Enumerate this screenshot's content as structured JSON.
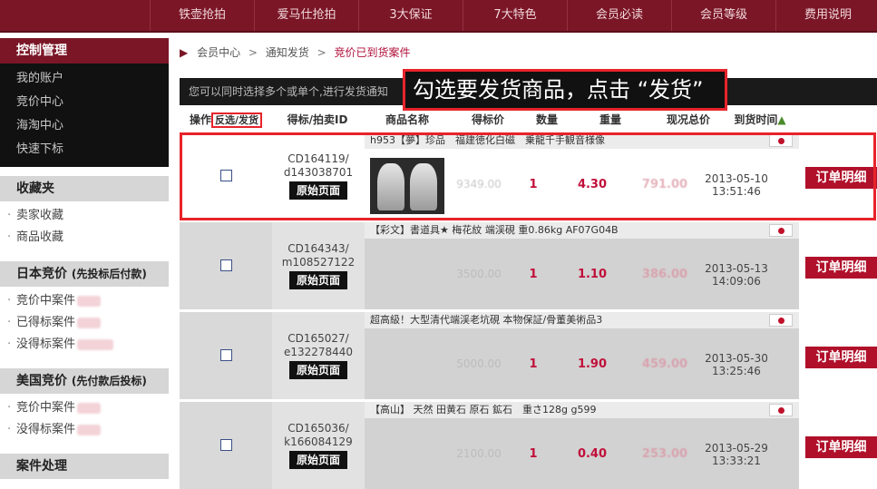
{
  "topnav": [
    "铁壶抢拍",
    "爱马仕抢拍",
    "3大保证",
    "7大特色",
    "会员必读",
    "会员等级",
    "费用说明"
  ],
  "sidebar": {
    "control_title": "控制管理",
    "control_links": [
      "我的账户",
      "竞价中心",
      "海淘中心",
      "快速下标"
    ],
    "fav_title": "收藏夹",
    "fav_links": [
      "卖家收藏",
      "商品收藏"
    ],
    "jp_title": "日本竞价",
    "jp_sub": "(先投标后付款)",
    "jp_links": [
      "竞价中案件",
      "已得标案件",
      "没得标案件"
    ],
    "us_title": "美国竞价",
    "us_sub": "(先付款后投标)",
    "us_links": [
      "竞价中案件",
      "没得标案件"
    ],
    "case_title": "案件处理"
  },
  "breadcrumb": {
    "home": "会员中心",
    "mid": "通知发货",
    "current": "竞价已到货案件",
    "sep": ">",
    "arrow": "▶"
  },
  "tip": "您可以同时选择多个或单个,进行发货通知",
  "callout": "勾选要发货商品，点击 “发货”",
  "table": {
    "headers": {
      "op": "操作",
      "op_box": "反选/发货",
      "id": "得标/拍卖ID",
      "name": "商品名称",
      "price": "得标价",
      "qty": "数量",
      "weight": "重量",
      "total": "现况总价",
      "time": "到货时间"
    },
    "orig_btn": "原始页面",
    "detail_btn": "订单明细",
    "rows": [
      {
        "id1": "CD164119/",
        "id2": "d143038701",
        "title": "h953【夢】珍品　福建徳化白磁　乗龍千手観音様像",
        "price": "9349.00",
        "qty": "1",
        "weight": "4.30",
        "total": "791.00",
        "date": "2013-05-10",
        "clock": "13:51:46"
      },
      {
        "id1": "CD164343/",
        "id2": "m108527122",
        "title": "【彩文】書道具★ 梅花紋 端渓硯 重0.86kg AF07G04B",
        "price": "3500.00",
        "qty": "1",
        "weight": "1.10",
        "total": "386.00",
        "date": "2013-05-13",
        "clock": "14:09:06"
      },
      {
        "id1": "CD165027/",
        "id2": "e132278440",
        "title": "超高級！大型清代端渓老坑硯 本物保証/骨董美術品3",
        "price": "5000.00",
        "qty": "1",
        "weight": "1.90",
        "total": "459.00",
        "date": "2013-05-30",
        "clock": "13:25:46"
      },
      {
        "id1": "CD165036/",
        "id2": "k166084129",
        "title": "【高山】 天然 田黄石 原石 鉱石　重さ128g g599",
        "price": "2100.00",
        "qty": "1",
        "weight": "0.40",
        "total": "253.00",
        "date": "2013-05-29",
        "clock": "13:33:21"
      }
    ]
  }
}
